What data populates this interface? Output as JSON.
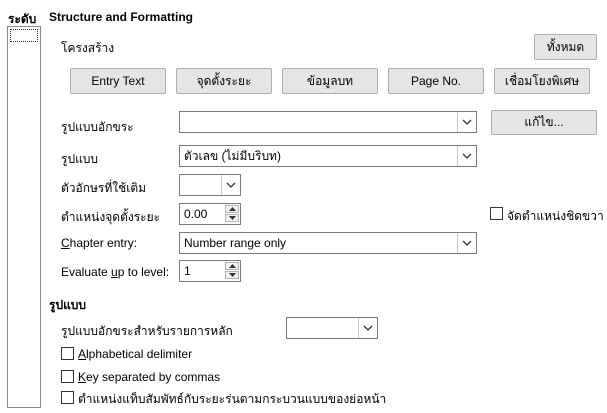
{
  "level": {
    "label": "ระดับ"
  },
  "structure": {
    "title": "Structure and Formatting",
    "subtitle": "โครงสร้าง",
    "all_button": "ทั้งหมด",
    "tokens": [
      "Entry Text",
      "จุดตั้งระยะ",
      "ข้อมูลบท",
      "Page No.",
      "เชื่อมโยงพิเศษ"
    ],
    "char_style_label": "รูปแบบอักขระ",
    "char_style_value": "",
    "edit_button": "แก้ไข...",
    "format_label": "รูปแบบ",
    "format_value": "ตัวเลข (ไม่มีบริบท)",
    "fill_char_label": "ตัวอักษรที่ใช้เติม",
    "fill_char_value": "",
    "tab_pos_label": "ตำแหน่งจุดตั้งระยะ",
    "tab_pos_value": "0.00",
    "align_right_label": "จัดตำแหน่งชิดขวา",
    "chapter_entry_label": "Chapter entry:",
    "chapter_entry_value": "Number range only",
    "eval_level_label": "Evaluate up to level:",
    "eval_level_value": "1"
  },
  "format": {
    "title": "รูปแบบ",
    "main_entries_label": "รูปแบบอักขระสำหรับรายการหลัก",
    "main_entries_value": "",
    "options": [
      {
        "label": "Alphabetical delimiter",
        "checked": false
      },
      {
        "label": "Key separated by commas",
        "checked": false
      },
      {
        "label": "ตำแหน่งแท็บสัมพัทธ์กับระยะร่นตามกระบวนแบบของย่อหน้า",
        "checked": false
      }
    ]
  }
}
